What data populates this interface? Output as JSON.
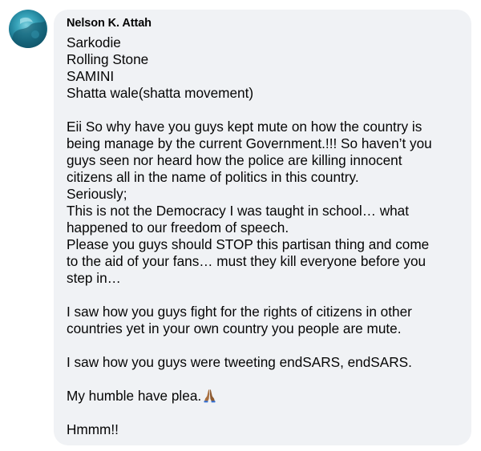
{
  "comment": {
    "author": "Nelson K. Attah",
    "lines": [
      "Sarkodie",
      "Rolling Stone",
      "SAMINI",
      "Shatta wale(shatta movement)",
      "",
      "Eii So why have you guys kept mute on how the country is",
      "being manage by the current Government.!!! So haven’t you",
      "guys seen nor heard how the police are killing innocent",
      "citizens all in the name of politics in this country.",
      "Seriously;",
      "This is not the Democracy I was taught in school… what",
      "happened to our freedom of speech.",
      "Please you guys should STOP this partisan thing and come",
      "to the aid of your fans… must they kill everyone before you",
      "step in…",
      "",
      "I saw how you guys fight for the rights of citizens in other",
      "countries yet in your own country you people are mute.",
      "",
      "I saw how you guys were tweeting endSARS, endSARS.",
      "",
      "My humble have plea.",
      "",
      "Hmmm!!"
    ],
    "emoji": "folded-hands-emoji",
    "colors": {
      "bubble": "#f0f2f5",
      "text": "#050505"
    }
  }
}
